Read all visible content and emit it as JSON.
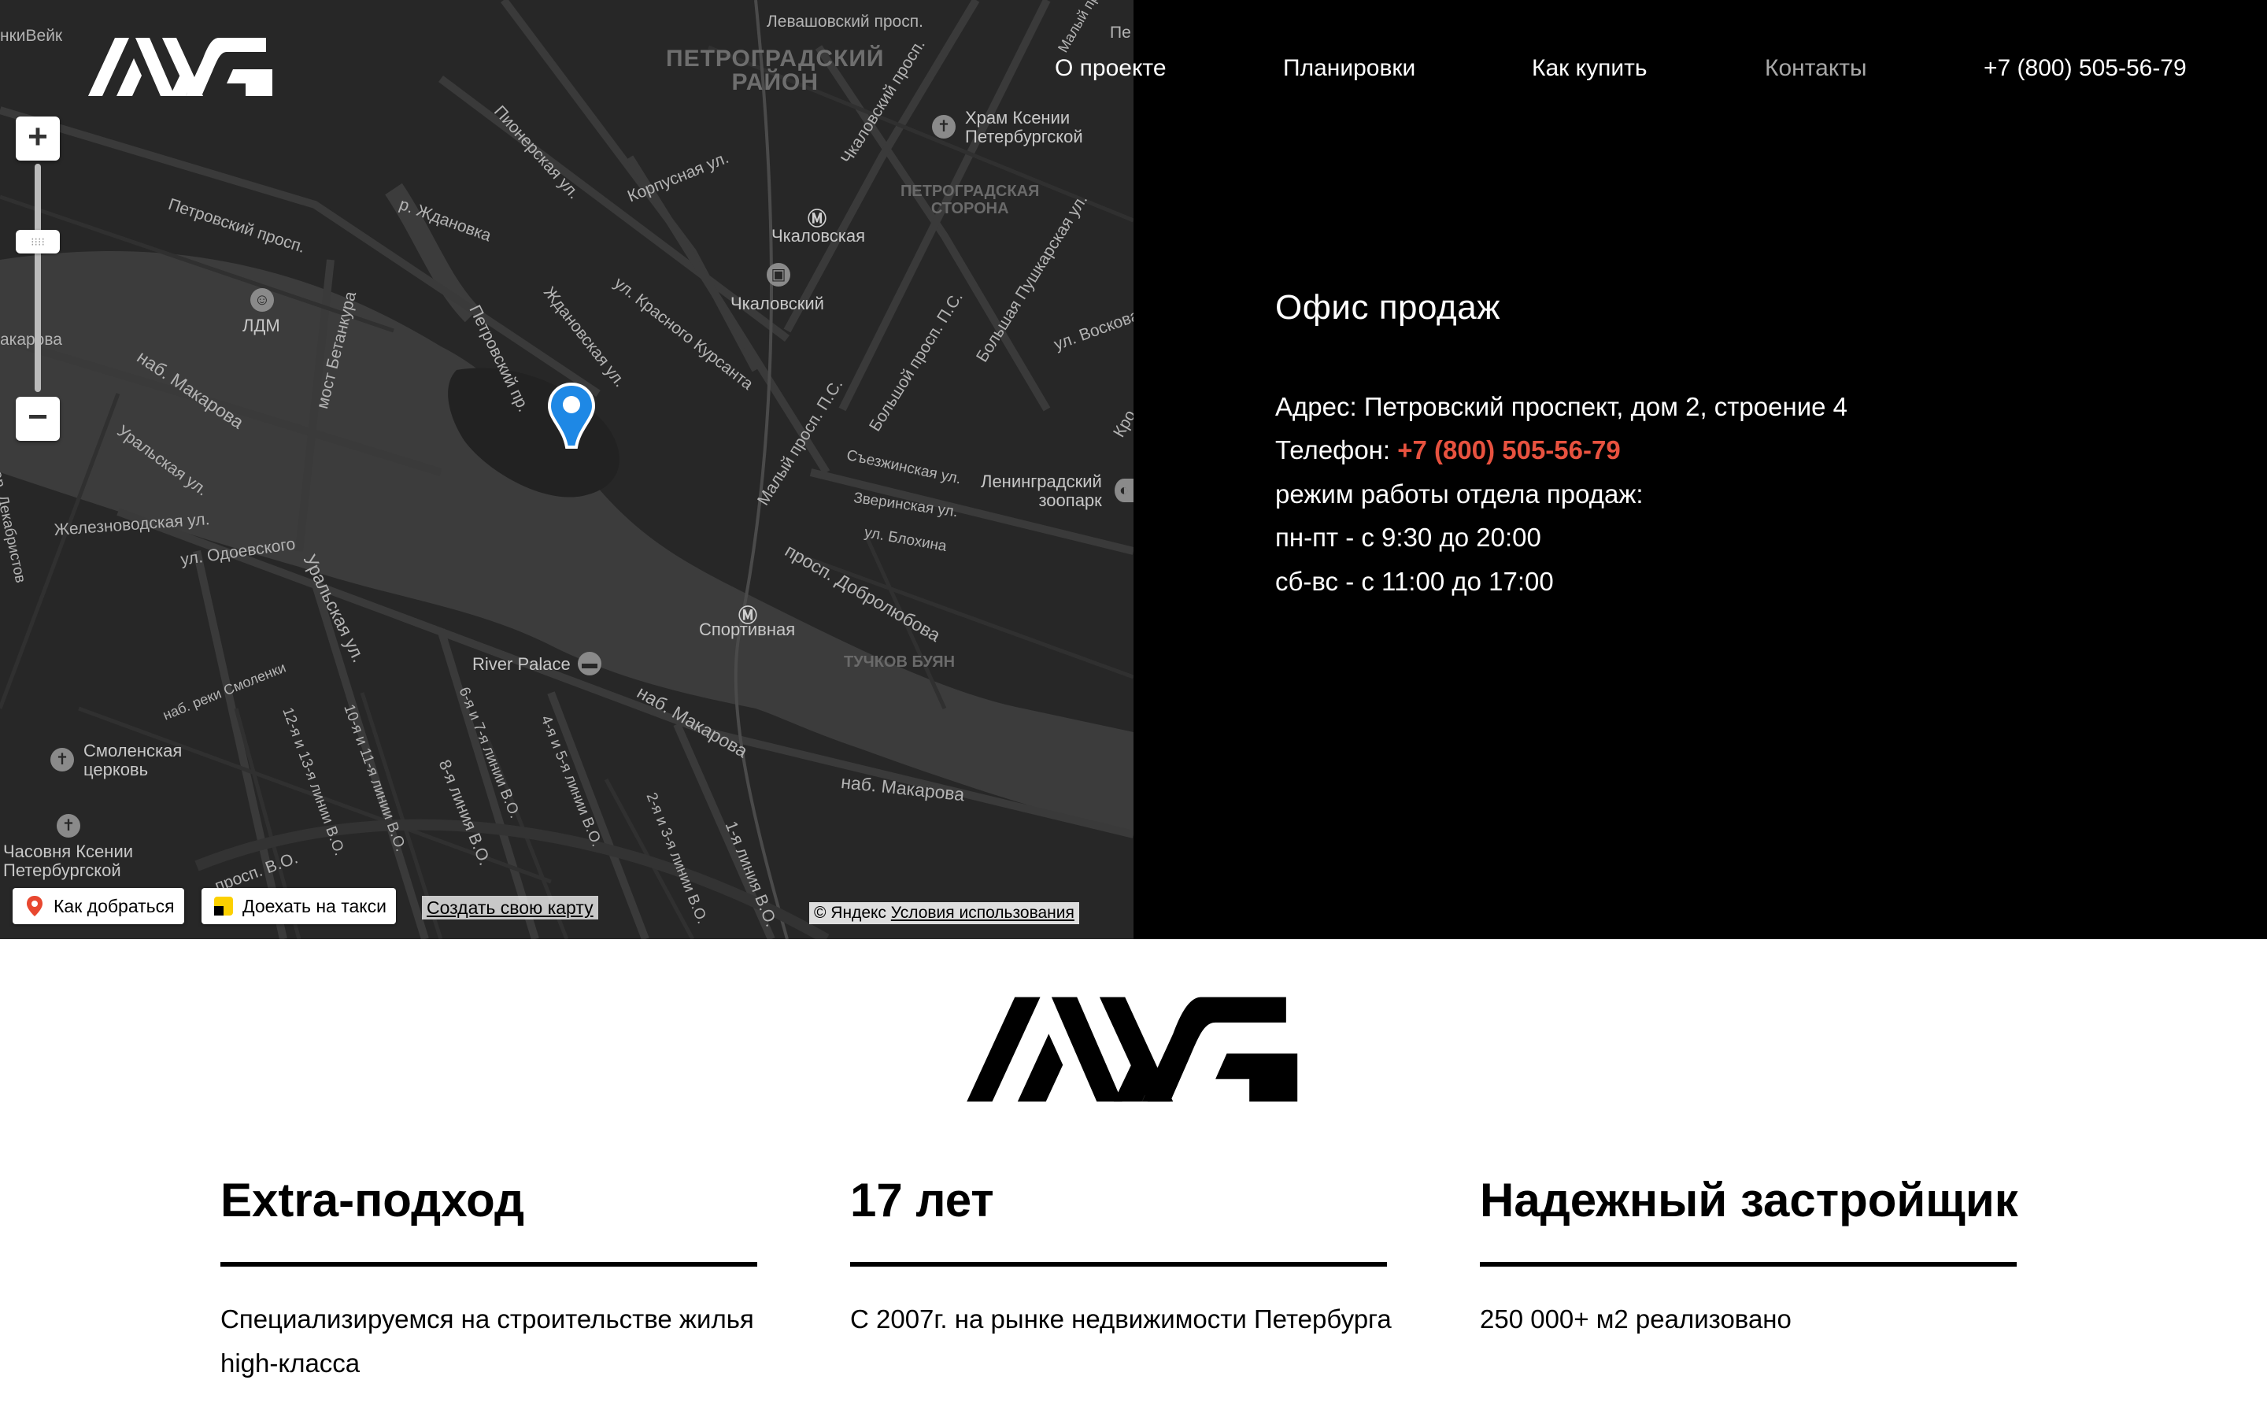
{
  "header": {
    "logo": "AAG",
    "nav": [
      {
        "label": "О проекте"
      },
      {
        "label": "Планировки"
      },
      {
        "label": "Как купить"
      },
      {
        "label": "Контакты"
      },
      {
        "label": "+7 (800) 505-56-79"
      }
    ]
  },
  "map": {
    "labels": {
      "district_1": "ПЕТРОГРАДСКИЙ",
      "district_2": "РАЙОН",
      "area_1": "ПЕТРОГРАДСКАЯ",
      "area_2": "СТОРОНА",
      "tuchkov": "ТУЧКОВ БУЯН",
      "levashovsky": "Левашовский просп.",
      "pionerskaya": "Пионерская ул.",
      "korpusnaya": "Корпусная ул.",
      "chkalovsky_pr": "Чкаловский просп.",
      "petrovsky_pr": "Петровский просп.",
      "zhdanovka": "р. Ждановка",
      "zhdanovskaya": "Ждановская ул.",
      "krasnogo_kursanta": "ул. Красного Курсанта",
      "petrovsky_pr2": "Петровский пр.",
      "nab_makarova_1": "наб. Макарова",
      "uralskaya_1": "Уральская ул.",
      "zheleznovodskaya": "Железноводская ул.",
      "odoevskogo": "ул. Одоевского",
      "uralskaya_2": "Уральская ул.",
      "betankura": "мост Бетанкура",
      "dekabristov": "пер. Декабристов",
      "makarova_left": "акарова",
      "krasnoy": "нкиВейк",
      "malyi_ps": "Малый просп. П.С.",
      "bolshoi_ps": "Большой просп. П.С.",
      "pushkarskaya": "Большая Пушкарская ул.",
      "voskova": "ул. Воскова",
      "sezzhinskaya": "Съезжинская ул.",
      "zverinskaya": "Зверинская ул.",
      "blokhina": "ул. Блохина",
      "dobrolyubova": "просп. Добролюбова",
      "nab_makarova_2": "наб. Макарова",
      "nab_makarova_3": "наб. Макарова",
      "smolenki": "наб. реки Смоленки",
      "line_12": "12-я и 13-я линии В.О.",
      "line_10": "10-я и 11-я линии В.О.",
      "line_8": "8-я линия В.О.",
      "line_6": "6-я и 7-я линии В.О.",
      "line_4": "4-я и 5-я линии В.О.",
      "line_2": "2-я и 3-я линии В.О.",
      "line_1": "1-я линия В.О.",
      "pe": "Пе",
      "malyi_top": "Малый просп.",
      "kron": "Кро",
      "sredny": "просп. В.О.",
      "a_left": "а"
    },
    "pois": {
      "xenia": "Храм Ксении\nПетербургской",
      "chkalovskaya": "Чкаловская",
      "chkalovsky": "Чкаловский",
      "ldm": "ЛДМ",
      "zoo": "Ленинградский\nзоопарк",
      "sportivnaya": "Спортивная",
      "river_palace": "River Palace",
      "smolenskaya": "Смоленская\nцерковь",
      "chasovnya": "Часовня Ксении\nПетербургской"
    },
    "buttons": {
      "route": "Как добраться",
      "taxi": "Доехать на такси",
      "create_map": "Создать свою карту",
      "copyright": "© Яндекс",
      "terms": "Условия использования"
    },
    "zoom": {
      "plus": "+",
      "minus": "−"
    }
  },
  "office": {
    "title": "Офис продаж",
    "address_label": "Адрес:",
    "address": "Петровский проспект, дом 2, строение 4",
    "phone_label": "Телефон:",
    "phone": "+7 (800) 505-56-79",
    "hours_title": "режим работы отдела продаж:",
    "weekdays": "пн-пт - с 9:30 до 20:00",
    "weekend": "сб-вс - с 11:00 до 17:00"
  },
  "features": [
    {
      "title": "Extra-подход",
      "text": "Специализируемся на строительстве жилья high-класса"
    },
    {
      "title": "17 лет",
      "text": "С 2007г. на рынке недвижимости Петербурга"
    },
    {
      "title": "Надежный застройщик",
      "text": "250 000+ м2 реализовано"
    }
  ],
  "colors": {
    "accent": "#e8523f",
    "background_top": "#000000",
    "map_bg": "#272727"
  }
}
